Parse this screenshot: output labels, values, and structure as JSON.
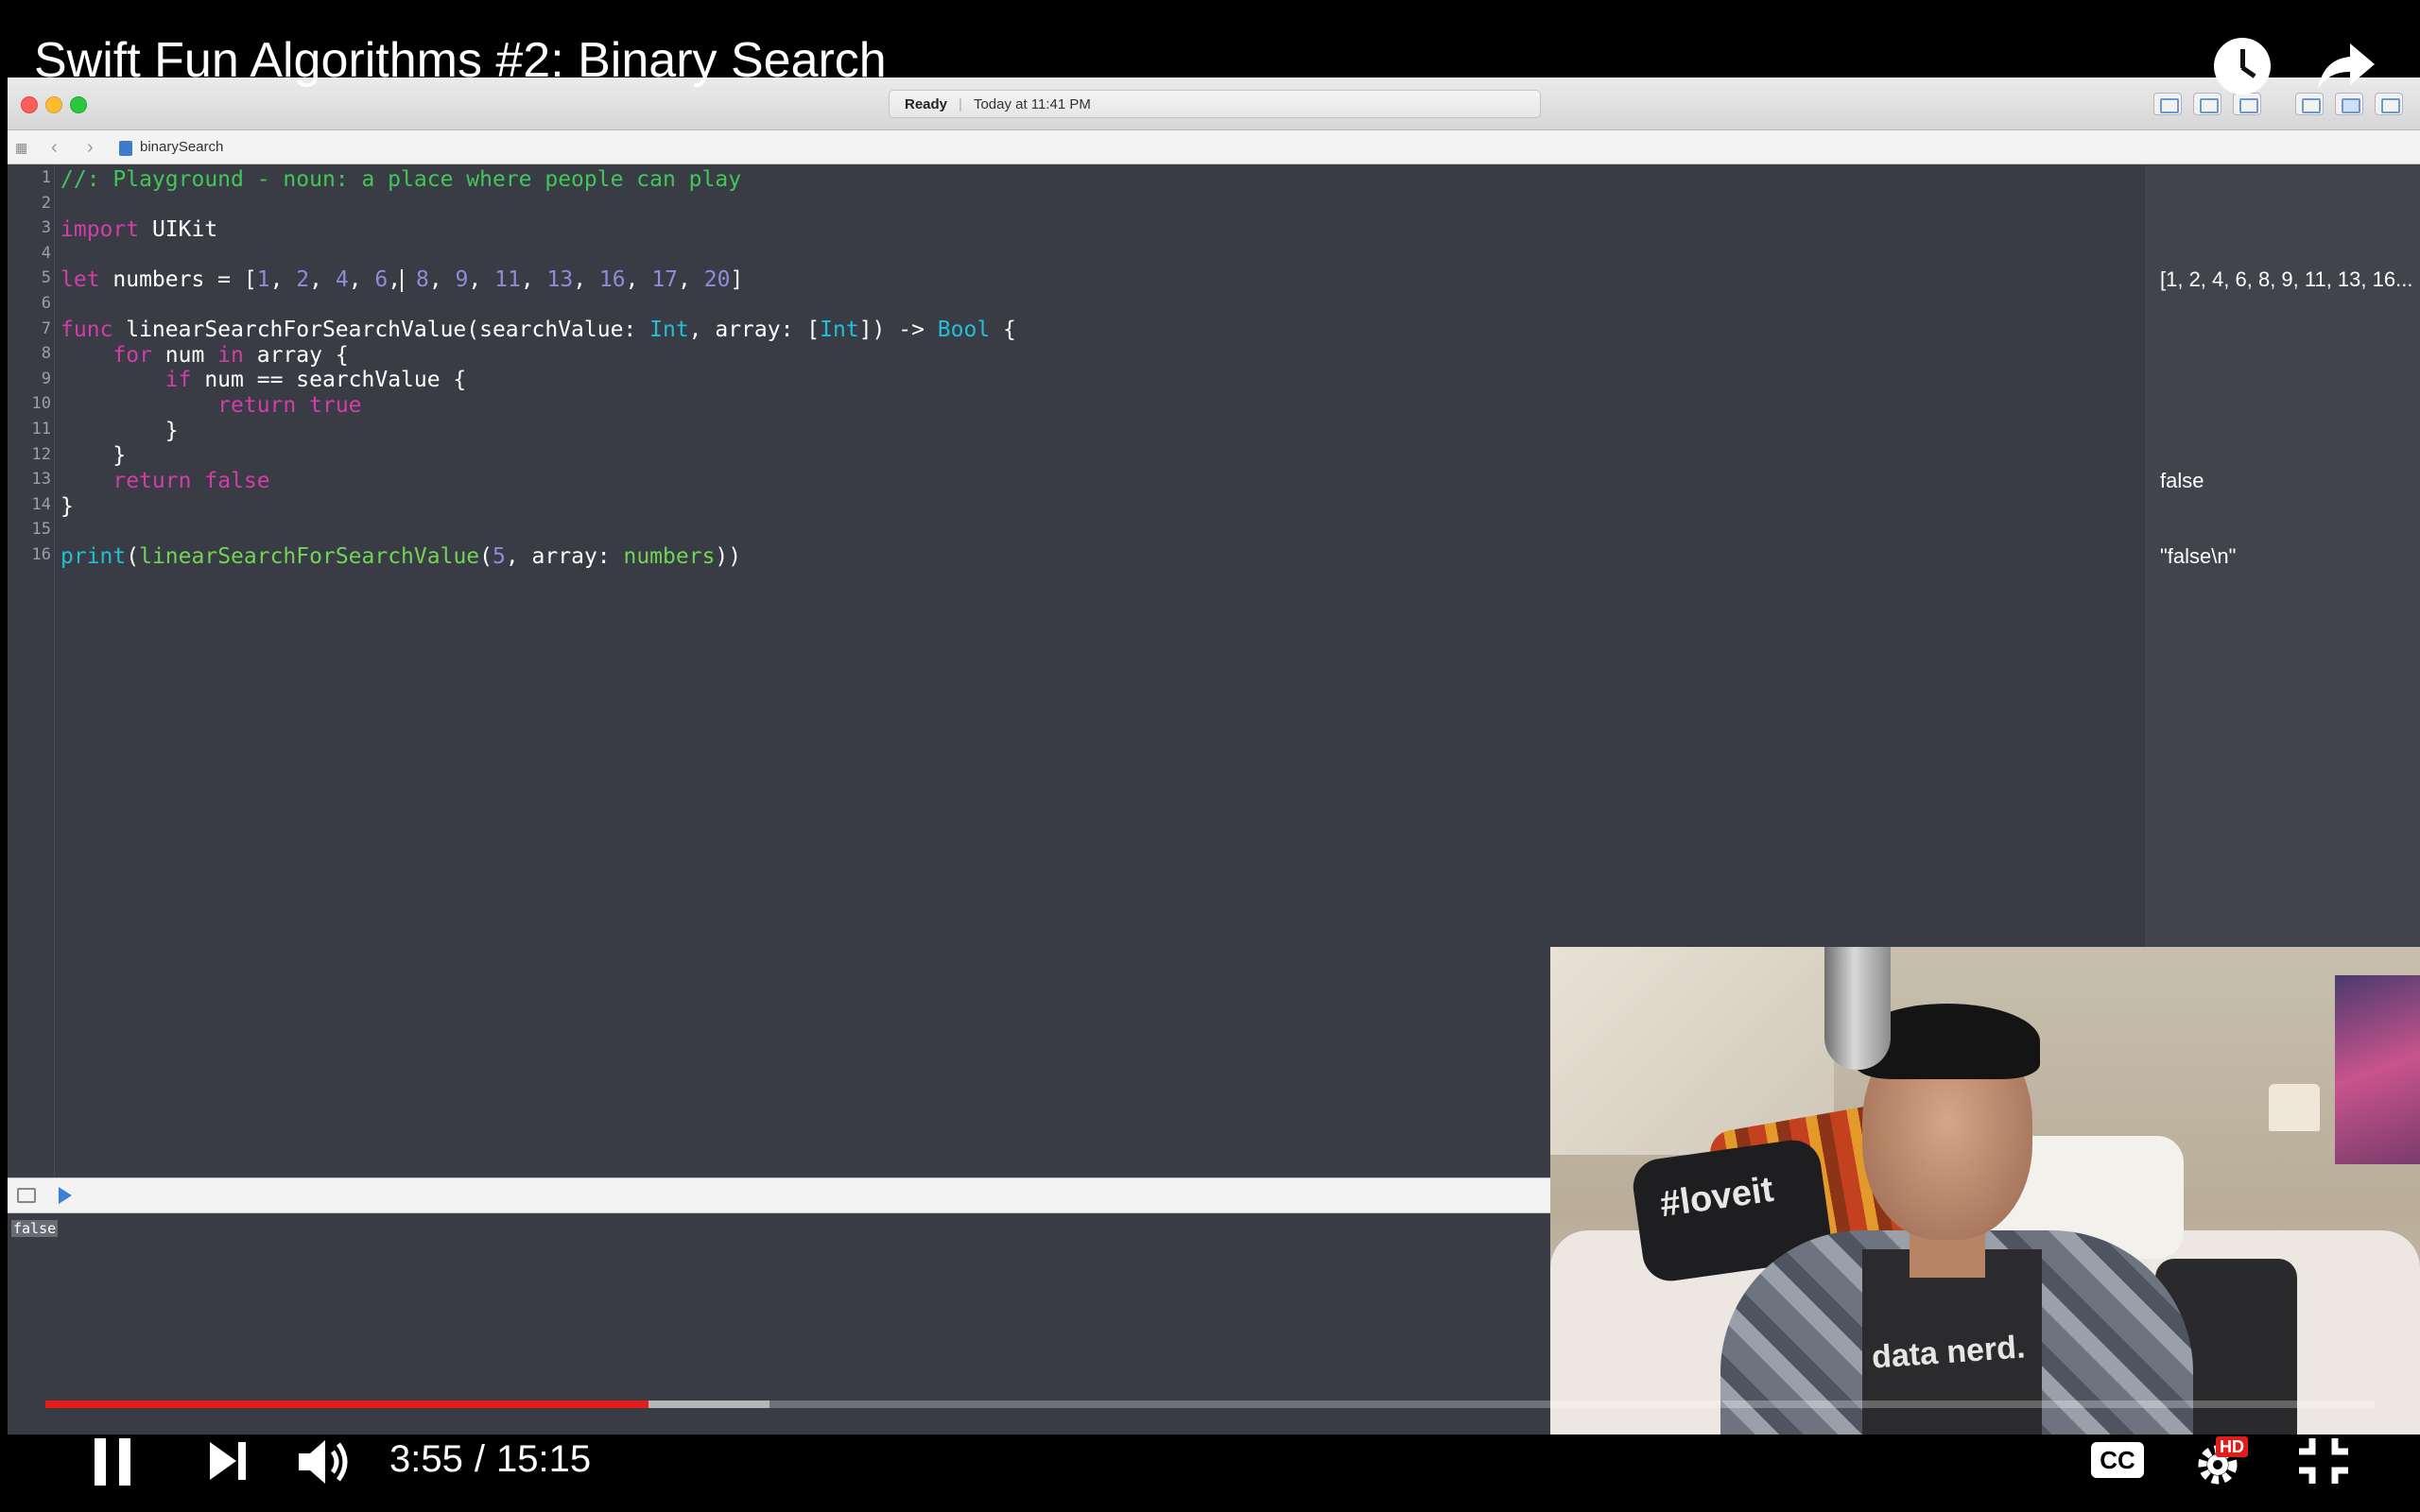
{
  "video": {
    "title": "Swift Fun Algorithms #2: Binary Search",
    "current_time": "3:55",
    "total_time": "15:15",
    "slash": "/",
    "played_fraction": 0.259,
    "buffered_fraction": 0.311,
    "cc_label": "CC",
    "hd_label": "HD"
  },
  "xcode": {
    "status_ready": "Ready",
    "status_sep": "|",
    "status_time": "Today at 11:41 PM",
    "file_name": "binarySearch",
    "console_output": "false"
  },
  "code": {
    "l1": "//: Playground - noun: a place where people can play",
    "l3_kw": "import",
    "l3_rest": " UIKit",
    "l5_kw": "let",
    "l5_a": " numbers = [",
    "l5_n1": "1",
    "l5_c1": ", ",
    "l5_n2": "2",
    "l5_c2": ", ",
    "l5_n3": "4",
    "l5_c3": ", ",
    "l5_n4": "6",
    "l5_c4": ",",
    "l5_c5": " ",
    "l5_n5": "8",
    "l5_c6": ", ",
    "l5_n6": "9",
    "l5_c7": ", ",
    "l5_n7": "11",
    "l5_c8": ", ",
    "l5_n8": "13",
    "l5_c9": ", ",
    "l5_n9": "16",
    "l5_c10": ", ",
    "l5_n10": "17",
    "l5_c11": ", ",
    "l5_n11": "20",
    "l5_end": "]",
    "l7_kw": "func",
    "l7_a": " linearSearchForSearchValue(searchValue: ",
    "l7_t1": "Int",
    "l7_b": ", array: [",
    "l7_t2": "Int",
    "l7_c": "]) -> ",
    "l7_t3": "Bool",
    "l7_d": " {",
    "l8_indent": "    ",
    "l8_kw1": "for",
    "l8_a": " num ",
    "l8_kw2": "in",
    "l8_b": " array {",
    "l9_indent": "        ",
    "l9_kw": "if",
    "l9_a": " num == searchValue {",
    "l10_indent": "            ",
    "l10_kw1": "return",
    "l10_sp": " ",
    "l10_kw2": "true",
    "l11": "        }",
    "l12": "    }",
    "l13_indent": "    ",
    "l13_kw1": "return",
    "l13_sp": " ",
    "l13_kw2": "false",
    "l14": "}",
    "l16_fn": "print",
    "l16_a": "(",
    "l16_fn2": "linearSearchForSearchValue",
    "l16_b": "(",
    "l16_n": "5",
    "l16_c": ", array: ",
    "l16_v": "numbers",
    "l16_d": "))"
  },
  "line_numbers": [
    "1",
    "2",
    "3",
    "4",
    "5",
    "6",
    "7",
    "8",
    "9",
    "10",
    "11",
    "12",
    "13",
    "14",
    "15",
    "16"
  ],
  "results": {
    "line5": "[1, 2, 4, 6, 8, 9, 11, 13, 16...",
    "line13": "false",
    "line16": "\"false\\n\""
  },
  "webcam": {
    "pillow_text": "#loveit",
    "shirt_text": "data nerd."
  },
  "colors": {
    "editor_bg": "#393b45",
    "keyword": "#d23ea8",
    "type": "#22c0d6",
    "number": "#8f8cd8",
    "comment": "#40c857",
    "progress_played": "#e21b1b"
  },
  "icons": [
    "watch-later-icon",
    "share-icon",
    "pause-icon",
    "next-icon",
    "volume-icon",
    "cc-icon",
    "settings-icon",
    "fullscreen-exit-icon",
    "play-icon",
    "grid-icon",
    "back-icon",
    "forward-icon",
    "file-icon"
  ]
}
